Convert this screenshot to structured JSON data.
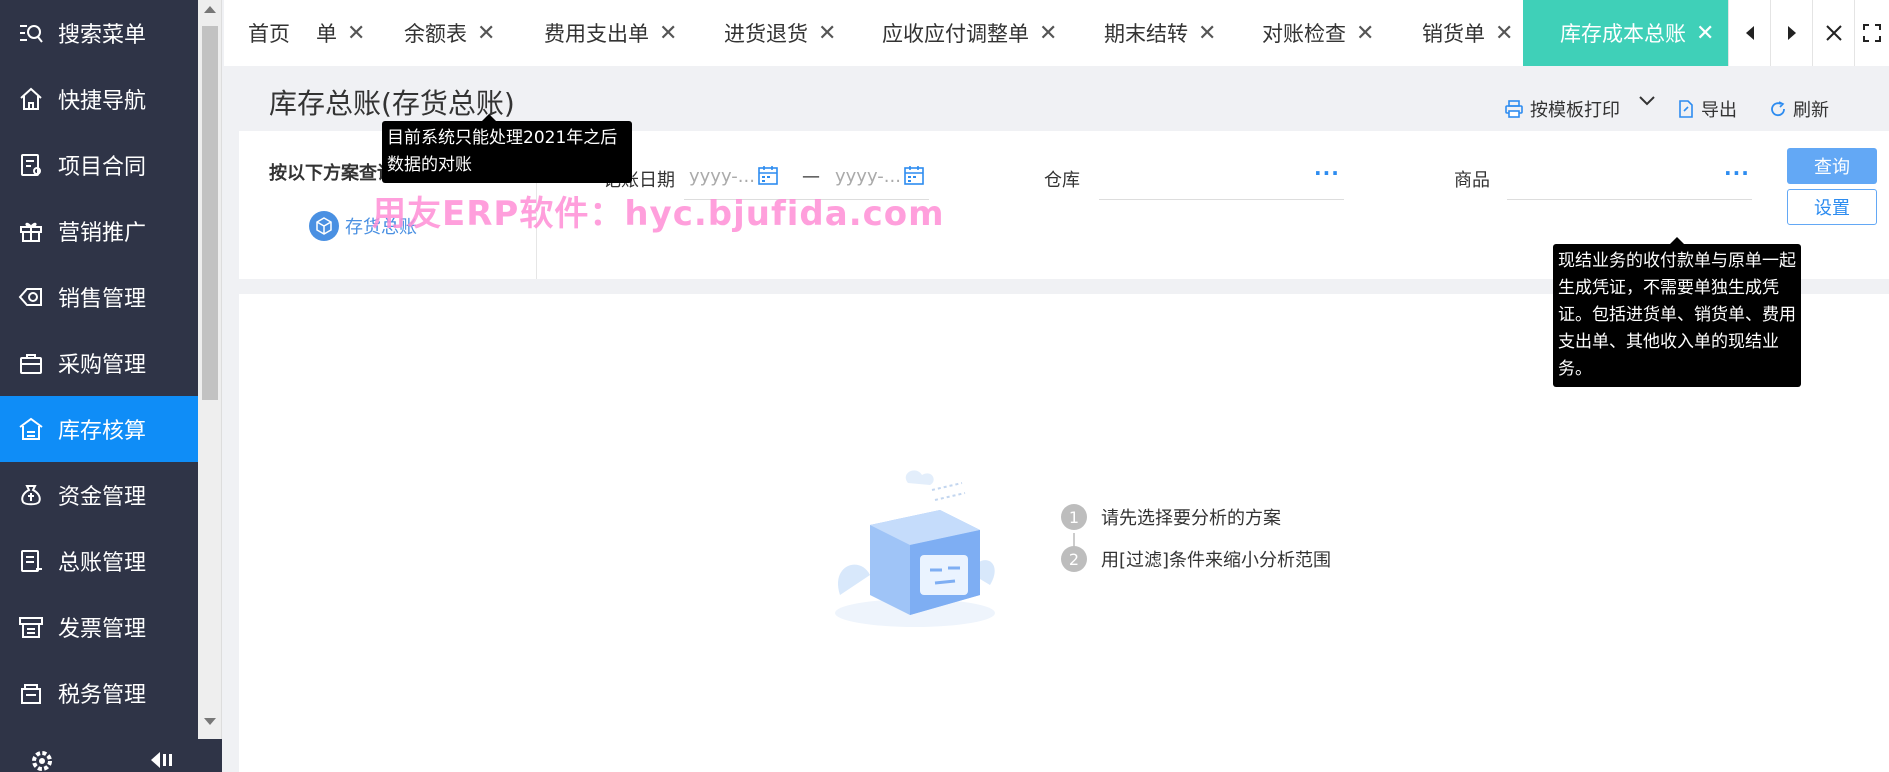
{
  "sidebar": {
    "items": [
      {
        "label": "搜索菜单",
        "icon": "search-menu-icon"
      },
      {
        "label": "快捷导航",
        "icon": "home-icon"
      },
      {
        "label": "项目合同",
        "icon": "contract-icon"
      },
      {
        "label": "营销推广",
        "icon": "gift-icon"
      },
      {
        "label": "销售管理",
        "icon": "sales-icon"
      },
      {
        "label": "采购管理",
        "icon": "bag-icon"
      },
      {
        "label": "库存核算",
        "icon": "warehouse-icon"
      },
      {
        "label": "资金管理",
        "icon": "money-bag-icon"
      },
      {
        "label": "总账管理",
        "icon": "ledger-icon"
      },
      {
        "label": "发票管理",
        "icon": "invoice-icon"
      },
      {
        "label": "税务管理",
        "icon": "tax-icon"
      }
    ],
    "active_index": 6
  },
  "tabs": [
    {
      "label": "首页",
      "closable": false
    },
    {
      "label": "单",
      "closable": true
    },
    {
      "label": "余额表",
      "closable": true
    },
    {
      "label": "费用支出单",
      "closable": true
    },
    {
      "label": "进货退货",
      "closable": true
    },
    {
      "label": "应收应付调整单",
      "closable": true
    },
    {
      "label": "期末结转",
      "closable": true
    },
    {
      "label": "对账检查",
      "closable": true
    },
    {
      "label": "销货单",
      "closable": true
    },
    {
      "label": "库存成本总账",
      "closable": true,
      "active": true
    }
  ],
  "page": {
    "title": "库存总账(存货总账)",
    "toolbar": {
      "print_label": "按模板打印",
      "export_label": "导出",
      "refresh_label": "刷新"
    }
  },
  "filter": {
    "scheme_label": "按以下方案查询",
    "scheme_link": "存货总账",
    "date_label": "记账日期",
    "date_start_placeholder": "yyyy-...",
    "date_sep": "—",
    "date_end_placeholder": "yyyy-...",
    "warehouse_label": "仓库",
    "product_label": "商品",
    "more": "···",
    "query_button": "查询",
    "settings_button": "设置"
  },
  "empty_state": {
    "step1_num": "1",
    "step1": "请先选择要分析的方案",
    "step2_num": "2",
    "step2": "用[过滤]条件来缩小分析范围"
  },
  "tooltips": {
    "tip1": "目前系统只能处理2021年之后数据的对账",
    "tip2": "现结业务的收付款单与原单一起生成凭证，不需要单独生成凭证。包括进货单、销货单、费用支出单、其他收入单的现结业务。"
  },
  "watermark": "用友ERP软件：hyc.bjufida.com",
  "colors": {
    "sidebar_bg": "#2f3447",
    "sidebar_active": "#0f8df7",
    "tab_active": "#3fd0b8",
    "link_blue": "#2d8cf0",
    "watermark": "#ff8fd6"
  }
}
